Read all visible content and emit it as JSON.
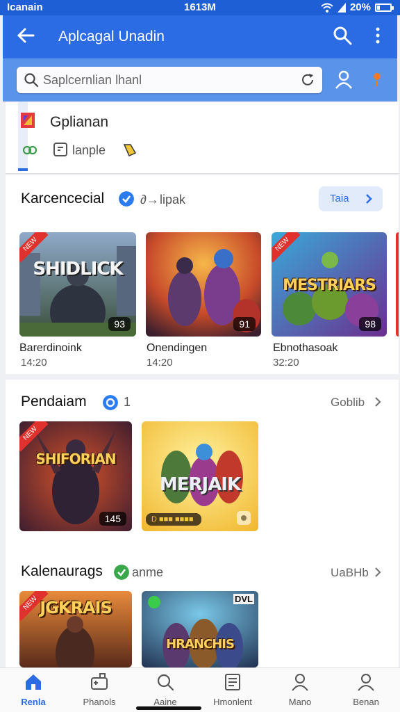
{
  "status": {
    "carrier": "Icanain",
    "time": "1613M",
    "battery": "20%",
    "battery_level": 0.2
  },
  "appbar": {
    "title": "Aplcagal Unadin"
  },
  "search": {
    "placeholder": "Saplcernlian lhanl"
  },
  "profile": {
    "name": "Gplianan",
    "label": "lanple"
  },
  "featured": {
    "title": "Karcencecial",
    "meta_1": "∂→",
    "meta_2": "lipak",
    "button": "Taia",
    "games": [
      {
        "word": "SHIDLICK",
        "score": "93",
        "caption": "Barerdinoink",
        "time": "14:20",
        "ribbon": "NEW"
      },
      {
        "word": "",
        "score": "91",
        "caption": "Onendingen",
        "time": "14:20",
        "ribbon": ""
      },
      {
        "word": "MESTRIARS",
        "score": "98",
        "caption": "Ebnothasoak",
        "time": "32:20",
        "ribbon": "NEW"
      }
    ]
  },
  "section2": {
    "title": "Pendaiam",
    "count": "1",
    "more": "Goblib",
    "games": [
      {
        "word": "SHIFORIAN",
        "score": "145",
        "ribbon": "NEW"
      },
      {
        "word": "MERJAIK",
        "score": "",
        "ribbon": "",
        "pill": "D  ■■■ ■■■■"
      }
    ]
  },
  "section3": {
    "title": "Kalenaurags",
    "sub": "anme",
    "more": "UaBHb",
    "games": [
      {
        "word": "JGKRAIS",
        "ribbon": "NEW"
      },
      {
        "word": "HRANCHIS",
        "ribbon": "",
        "corner": "DVL"
      }
    ]
  },
  "tabs": [
    {
      "label": "Renla",
      "icon": "home-icon",
      "active": true
    },
    {
      "label": "Phanols",
      "icon": "gamepad-icon",
      "active": false
    },
    {
      "label": "Aaine",
      "icon": "search-icon",
      "active": false
    },
    {
      "label": "Hmonlent",
      "icon": "list-icon",
      "active": false
    },
    {
      "label": "Mano",
      "icon": "person-icon",
      "active": false
    },
    {
      "label": "Benan",
      "icon": "account-icon",
      "active": false
    }
  ],
  "colors": {
    "primary": "#2b6be3",
    "statusbar": "#1f5fd6",
    "search_strip": "#5a93ea",
    "ribbon": "#e0312c"
  }
}
